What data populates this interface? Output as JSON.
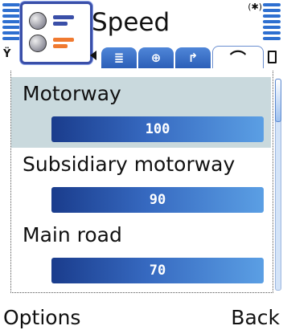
{
  "header": {
    "title": "Speed"
  },
  "tabs": [
    {
      "icon": "list-icon",
      "glyph": "≣"
    },
    {
      "icon": "globe-icon",
      "glyph": "⊕"
    },
    {
      "icon": "route-arrow-icon",
      "glyph": "↱"
    },
    {
      "icon": "speedometer-icon",
      "glyph": "⌒",
      "active": true
    }
  ],
  "items": [
    {
      "label": "Motorway",
      "value": "100",
      "selected": true
    },
    {
      "label": "Subsidiary motorway",
      "value": "90"
    },
    {
      "label": "Main road",
      "value": "70"
    }
  ],
  "softkeys": {
    "left": "Options",
    "right": "Back"
  },
  "colors": {
    "accent": "#2e6fd0",
    "bar_dark": "#1a3c8c",
    "bar_light": "#5b9fe4",
    "selection": "#c9d9dd"
  }
}
